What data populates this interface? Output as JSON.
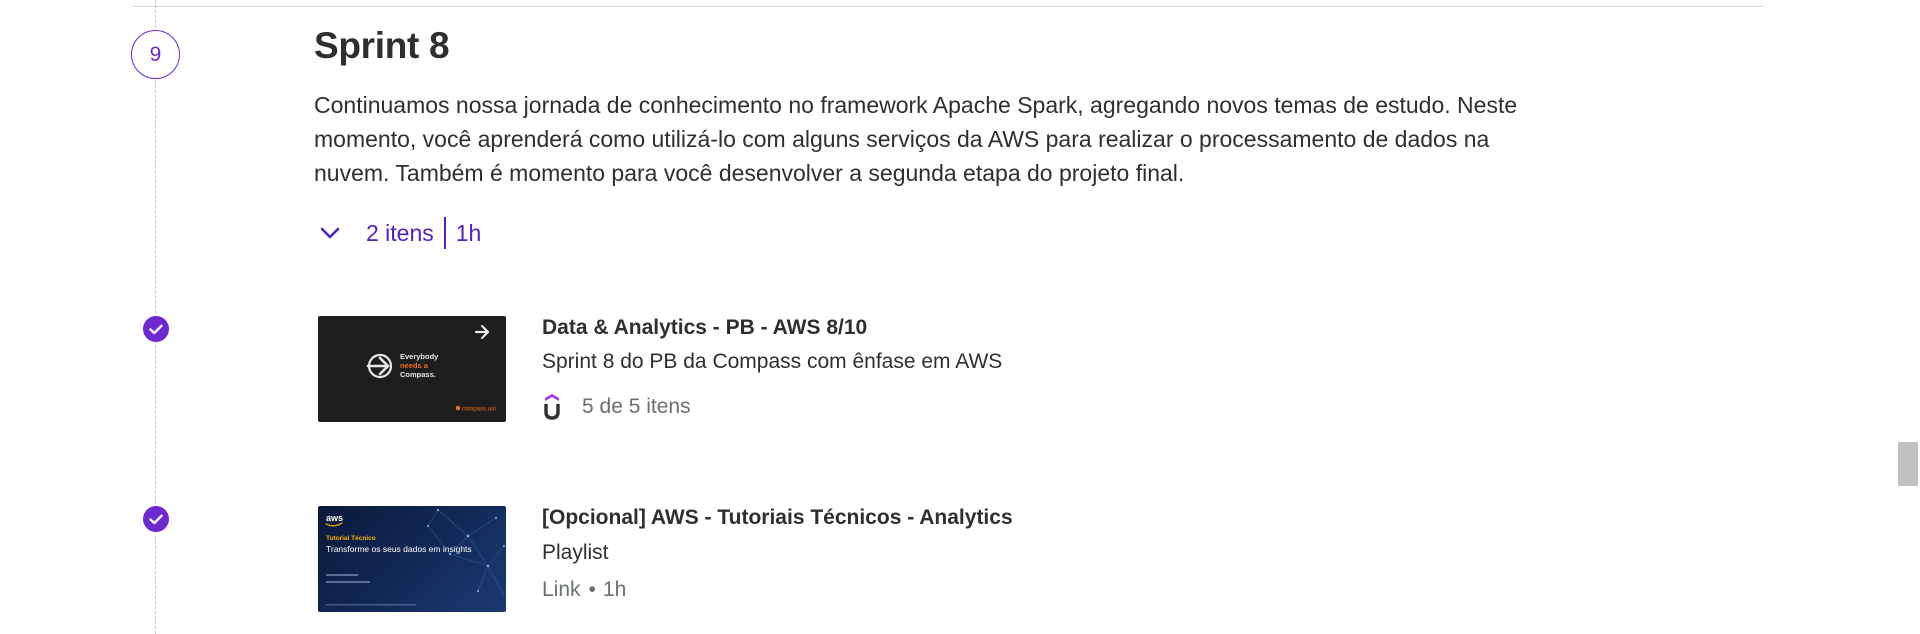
{
  "section": {
    "number": "9",
    "title": "Sprint 8",
    "description": "Continuamos nossa jornada de conhecimento no framework Apache Spark, agregando novos temas de estudo. Neste momento, você aprenderá como utilizá-lo com alguns serviços da AWS para realizar o processamento de dados na nuvem. Também é momento para você desenvolver a segunda etapa do projeto final.",
    "items_count": "2 itens",
    "duration": "1h"
  },
  "items": [
    {
      "title": "Data & Analytics - PB - AWS 8/10",
      "subtitle": "Sprint 8 do PB da Compass com ênfase em AWS",
      "progress": "5 de 5 itens",
      "completed": true,
      "thumbnail": {
        "tagline_1": "Everybody",
        "tagline_2": "needs a",
        "tagline_3": "Compass.",
        "brand": "compass.uol"
      }
    },
    {
      "title": "[Opcional] AWS - Tutoriais Técnicos - Analytics",
      "subtitle": "Playlist",
      "type": "Link",
      "duration": "1h",
      "completed": true,
      "thumbnail": {
        "logo": "aws",
        "label": "Tutorial Técnico",
        "headline": "Transforme os seus dados em insights"
      }
    }
  ],
  "colors": {
    "accent": "#6d28d2",
    "link": "#5022c3",
    "text": "#2d2f31",
    "muted": "#6a6f73",
    "compass_orange": "#f26b1d",
    "aws_yellow": "#ffb000"
  }
}
